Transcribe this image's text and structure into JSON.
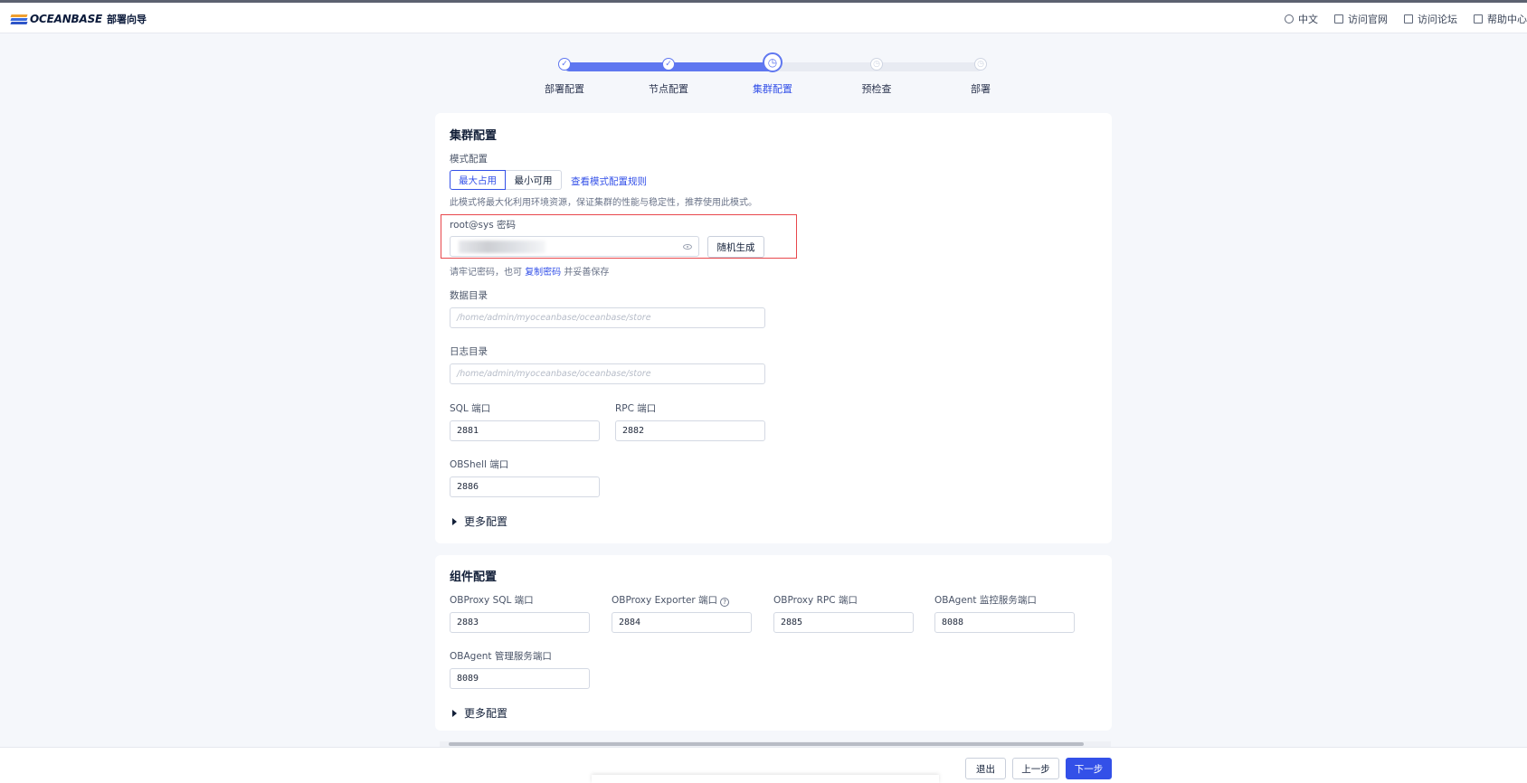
{
  "header": {
    "logo_text": "OCEANBASE",
    "logo_sub": "部署向导",
    "nav": [
      {
        "label": "中文",
        "icon": "globe-icon"
      },
      {
        "label": "访问官网",
        "icon": "home-icon"
      },
      {
        "label": "访问论坛",
        "icon": "forum-icon"
      },
      {
        "label": "帮助中心",
        "icon": "help-book-icon"
      }
    ]
  },
  "steps": [
    {
      "label": "部署配置",
      "state": "done",
      "icon": "✓"
    },
    {
      "label": "节点配置",
      "state": "done",
      "icon": "✓"
    },
    {
      "label": "集群配置",
      "state": "current",
      "icon": "◷"
    },
    {
      "label": "预检查",
      "state": "todo",
      "icon": "◷"
    },
    {
      "label": "部署",
      "state": "todo",
      "icon": "◷"
    }
  ],
  "cluster": {
    "title": "集群配置",
    "mode_label": "模式配置",
    "mode_options": [
      "最大占用",
      "最小可用"
    ],
    "mode_selected": "最大占用",
    "mode_rules_link": "查看模式配置规则",
    "mode_desc": "此模式将最大化利用环境资源，保证集群的性能与稳定性，推荐使用此模式。",
    "password_label": "root@sys 密码",
    "random_button": "随机生成",
    "password_hint_prefix": "请牢记密码，也可",
    "password_hint_link": "复制密码",
    "password_hint_suffix": "并妥善保存",
    "data_dir_label": "数据目录",
    "data_dir_placeholder": "/home/admin/myoceanbase/oceanbase/store",
    "log_dir_label": "日志目录",
    "log_dir_placeholder": "/home/admin/myoceanbase/oceanbase/store",
    "sql_port_label": "SQL 端口",
    "sql_port": "2881",
    "rpc_port_label": "RPC 端口",
    "rpc_port": "2882",
    "obshell_port_label": "OBShell 端口",
    "obshell_port": "2886",
    "more_label": "更多配置"
  },
  "components": {
    "title": "组件配置",
    "obproxy_sql_label": "OBProxy SQL 端口",
    "obproxy_sql": "2883",
    "obproxy_exporter_label": "OBProxy Exporter 端口",
    "obproxy_exporter": "2884",
    "obproxy_rpc_label": "OBProxy RPC 端口",
    "obproxy_rpc": "2885",
    "obagent_monitor_label": "OBAgent 监控服务端口",
    "obagent_monitor": "8088",
    "obagent_manage_label": "OBAgent 管理服务端口",
    "obagent_manage": "8089",
    "more_label": "更多配置"
  },
  "footer": {
    "exit": "退出",
    "prev": "上一步",
    "next": "下一步"
  },
  "colors": {
    "primary": "#3350e8",
    "highlight": "#e8474c"
  }
}
